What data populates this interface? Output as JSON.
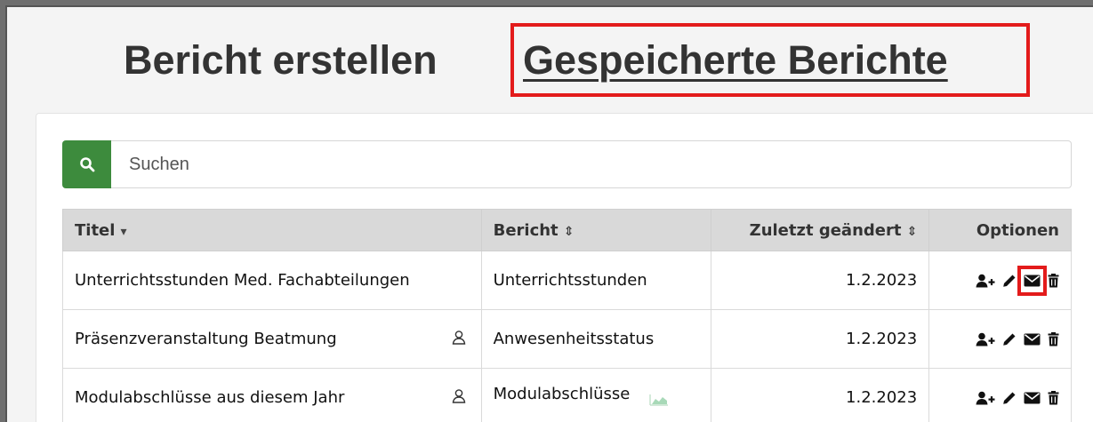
{
  "header": {
    "tab_create": "Bericht erstellen",
    "tab_saved": "Gespeicherte Berichte"
  },
  "search": {
    "placeholder": "Suchen",
    "button_icon": "search-icon"
  },
  "table": {
    "columns": [
      {
        "label": "Titel",
        "sort_icon": "caret-down"
      },
      {
        "label": "Bericht",
        "sort_icon": "sort-both"
      },
      {
        "label": "Zuletzt geändert",
        "sort_icon": "sort-both"
      },
      {
        "label": "Optionen"
      }
    ],
    "sort_glyphs": {
      "caret-down": "▾",
      "sort-both": "⇕"
    },
    "rows": [
      {
        "title": "Unterrichtsstunden Med. Fachabteilungen",
        "report": "Unterrichtsstunden",
        "date": "1.2.2023",
        "personal": false,
        "chart": false
      },
      {
        "title": "Präsenzveranstaltung Beatmung",
        "report": "Anwesenheitsstatus",
        "date": "1.2.2023",
        "personal": true,
        "chart": false
      },
      {
        "title": "Modulabschlüsse aus diesem Jahr",
        "report": "Modulabschlüsse",
        "date": "1.2.2023",
        "personal": true,
        "chart": true
      }
    ],
    "option_icons": [
      "share-user-icon",
      "edit-pencil-icon",
      "mail-icon",
      "trash-icon"
    ]
  },
  "colors": {
    "accent_green": "#3d8b3d",
    "highlight_red": "#e31b1b",
    "header_gray": "#d9d9d9"
  }
}
